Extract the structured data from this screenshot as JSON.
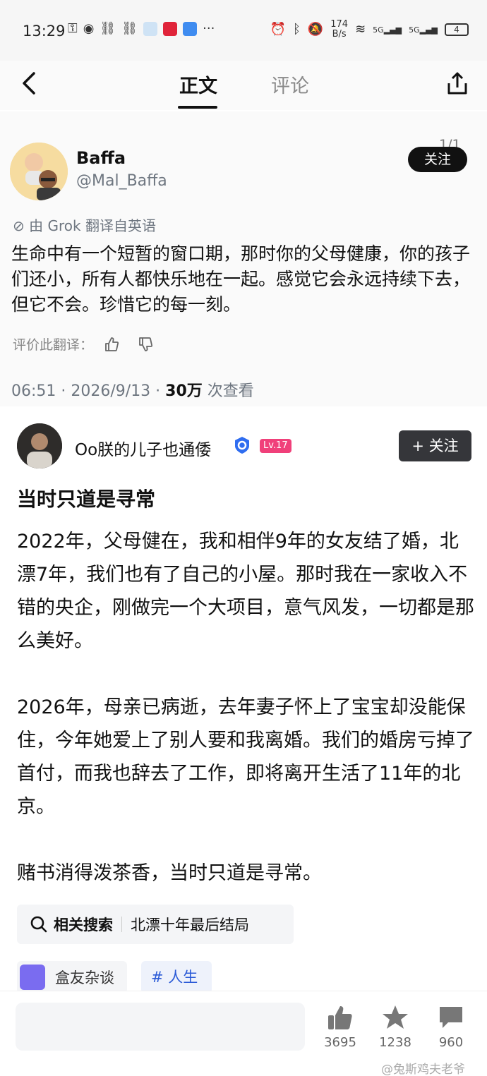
{
  "status_bar": {
    "time": "13:29",
    "net_speed_value": "174",
    "net_speed_unit": "B/s",
    "signal_1": "5G",
    "signal_2": "5G",
    "battery": "4"
  },
  "nav": {
    "tab_main": "正文",
    "tab_comments": "评论"
  },
  "embed": {
    "name": "Baffa",
    "handle": "@Mal_Baffa",
    "follow": "关注",
    "counter": "1/1",
    "translated_note": "由 Grok 翻译自英语",
    "body": "生命中有一个短暂的窗口期，那时你的父母健康，你的孩子们还小，所有人都快乐地在一起。感觉它会永远持续下去，但它不会。珍惜它的每一刻。",
    "rate_label": "评价此翻译：",
    "meta_time": "06:51 · 2026/9/13 · ",
    "meta_views": "30万",
    "meta_views_suffix": " 次查看"
  },
  "post": {
    "author": "Oo朕的儿子也通倭",
    "level": "Lv.17",
    "follow": "+ 关注",
    "title": "当时只道是寻常",
    "paragraphs": [
      "2022年，父母健在，我和相伴9年的女友结了婚，北漂7年，我们也有了自己的小屋。那时我在一家收入不错的央企，刚做完一个大项目，意气风发，一切都是那么美好。",
      "2026年，母亲已病逝，去年妻子怀上了宝宝却没能保住，今年她爱上了别人要和我离婚。我们的婚房亏掉了首付，而我也辞去了工作，即将离开生活了11年的北京。",
      "赌书消得泼茶香，当时只道是寻常。"
    ],
    "related_label": "相关搜索",
    "related_query": "北漂十年最后结局",
    "circle": "盒友杂谈",
    "hashtag": "# 人生"
  },
  "bottom": {
    "likes": "3695",
    "favorites": "1238",
    "comments": "960",
    "watermark": "@兔斯鸡夫老爷"
  },
  "colors": {
    "follow_dark": "#35363a",
    "level_badge": "#f0407a",
    "hashtag_blue": "#2b5bd7",
    "circle_purple": "#7a6cf0"
  }
}
